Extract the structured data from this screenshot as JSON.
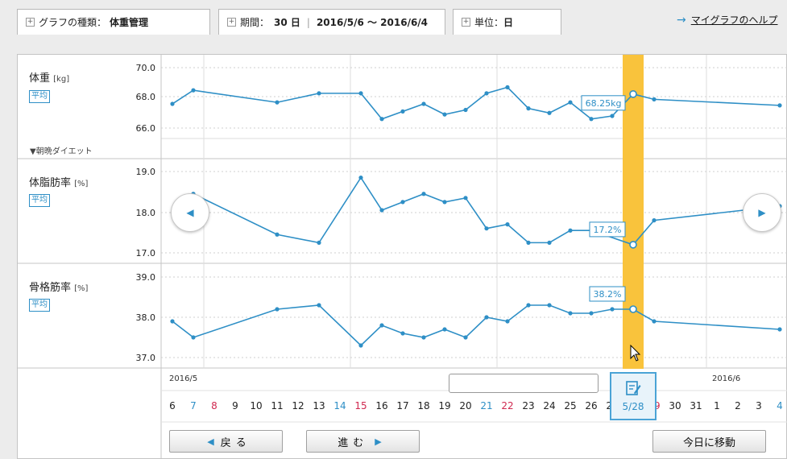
{
  "tabs": {
    "graph_type_label": "グラフの種類：",
    "graph_type_value": "体重管理",
    "period_label": "期間：",
    "period_days": "30 日",
    "period_range": "2016/5/6 〜 2016/6/4",
    "unit_label": "単位：",
    "unit_value": "日"
  },
  "help_link": "マイグラフのヘルプ",
  "rows": [
    {
      "title": "体重",
      "unit": "[kg]",
      "avg": "平均",
      "extra": "▼朝晩ダイエット",
      "ticks": [
        "70.0",
        "68.0",
        "66.0"
      ],
      "tooltip": "68.25kg"
    },
    {
      "title": "体脂肪率",
      "unit": "[%]",
      "avg": "平均",
      "ticks": [
        "19.0",
        "18.0",
        "17.0"
      ],
      "tooltip": "17.2%"
    },
    {
      "title": "骨格筋率",
      "unit": "[%]",
      "avg": "平均",
      "ticks": [
        "39.0",
        "38.0",
        "37.0"
      ],
      "tooltip": "38.2%"
    }
  ],
  "chart_data": [
    {
      "type": "line",
      "title": "体重 [kg]",
      "ylim": [
        65.3,
        70.4
      ],
      "points": [
        [
          6,
          67.6
        ],
        [
          7,
          68.5
        ],
        [
          11,
          67.7
        ],
        [
          13,
          68.3
        ],
        [
          15,
          68.3
        ],
        [
          16,
          66.6
        ],
        [
          17,
          67.1
        ],
        [
          18,
          67.6
        ],
        [
          19,
          66.9
        ],
        [
          20,
          67.2
        ],
        [
          21,
          68.3
        ],
        [
          22,
          68.7
        ],
        [
          23,
          67.3
        ],
        [
          24,
          67.0
        ],
        [
          25,
          67.7
        ],
        [
          26,
          66.6
        ],
        [
          27,
          66.8
        ],
        [
          28,
          68.25
        ],
        [
          29,
          67.9
        ],
        [
          35,
          67.5
        ]
      ],
      "selected_x": 28,
      "selected_label": "68.25kg"
    },
    {
      "type": "line",
      "title": "体脂肪率 [%]",
      "ylim": [
        16.75,
        19.25
      ],
      "points": [
        [
          7,
          18.45
        ],
        [
          11,
          17.45
        ],
        [
          13,
          17.25
        ],
        [
          15,
          18.85
        ],
        [
          16,
          18.05
        ],
        [
          17,
          18.25
        ],
        [
          18,
          18.45
        ],
        [
          19,
          18.25
        ],
        [
          20,
          18.35
        ],
        [
          21,
          17.6
        ],
        [
          22,
          17.7
        ],
        [
          23,
          17.25
        ],
        [
          24,
          17.25
        ],
        [
          25,
          17.55
        ],
        [
          26,
          17.55
        ],
        [
          28,
          17.2
        ],
        [
          29,
          17.8
        ],
        [
          35,
          18.15
        ]
      ],
      "selected_x": 28,
      "selected_label": "17.2%"
    },
    {
      "type": "line",
      "title": "骨格筋率 [%]",
      "ylim": [
        36.7,
        39.2
      ],
      "points": [
        [
          6,
          37.9
        ],
        [
          7,
          37.5
        ],
        [
          11,
          38.2
        ],
        [
          13,
          38.3
        ],
        [
          15,
          37.3
        ],
        [
          16,
          37.8
        ],
        [
          17,
          37.6
        ],
        [
          18,
          37.5
        ],
        [
          19,
          37.7
        ],
        [
          20,
          37.5
        ],
        [
          21,
          38.0
        ],
        [
          22,
          37.9
        ],
        [
          23,
          38.3
        ],
        [
          24,
          38.3
        ],
        [
          25,
          38.1
        ],
        [
          26,
          38.1
        ],
        [
          27,
          38.2
        ],
        [
          28,
          38.2
        ],
        [
          29,
          37.9
        ],
        [
          35,
          37.7
        ]
      ],
      "selected_x": 28,
      "selected_label": "38.2%"
    }
  ],
  "timeline": {
    "month1": "2016/5",
    "month2": "2016/6",
    "days": [
      {
        "label": "6",
        "color": "#222"
      },
      {
        "label": "7",
        "color": "#2e8fc6"
      },
      {
        "label": "8",
        "color": "#d0284f"
      },
      {
        "label": "9",
        "color": "#222"
      },
      {
        "label": "10",
        "color": "#222"
      },
      {
        "label": "11",
        "color": "#222"
      },
      {
        "label": "12",
        "color": "#222"
      },
      {
        "label": "13",
        "color": "#222"
      },
      {
        "label": "14",
        "color": "#2e8fc6"
      },
      {
        "label": "15",
        "color": "#d0284f"
      },
      {
        "label": "16",
        "color": "#222"
      },
      {
        "label": "17",
        "color": "#222"
      },
      {
        "label": "18",
        "color": "#222"
      },
      {
        "label": "19",
        "color": "#222"
      },
      {
        "label": "20",
        "color": "#222"
      },
      {
        "label": "21",
        "color": "#2e8fc6"
      },
      {
        "label": "22",
        "color": "#d0284f"
      },
      {
        "label": "23",
        "color": "#222"
      },
      {
        "label": "24",
        "color": "#222"
      },
      {
        "label": "25",
        "color": "#222"
      },
      {
        "label": "26",
        "color": "#222"
      },
      {
        "label": "27",
        "color": "#222"
      },
      {
        "label": "28",
        "color": "#2e8fc6"
      },
      {
        "label": "29",
        "color": "#d0284f"
      },
      {
        "label": "30",
        "color": "#222"
      },
      {
        "label": "31",
        "color": "#222"
      },
      {
        "label": "1",
        "color": "#222"
      },
      {
        "label": "2",
        "color": "#222"
      },
      {
        "label": "3",
        "color": "#222"
      },
      {
        "label": "4",
        "color": "#2e8fc6"
      }
    ],
    "selected_date": "5/28"
  },
  "buttons": {
    "back": "戻る",
    "forward": "進む",
    "today": "今日に移動"
  },
  "icons": {
    "left": "chevron-left-icon",
    "right": "chevron-right-icon",
    "edit": "edit-note-icon",
    "cursor": "mouse-cursor-icon"
  },
  "colors": {
    "accent": "#2e8fc6",
    "highlight": "#f9c33c",
    "sunday": "#d0284f",
    "saturday": "#2e8fc6"
  }
}
